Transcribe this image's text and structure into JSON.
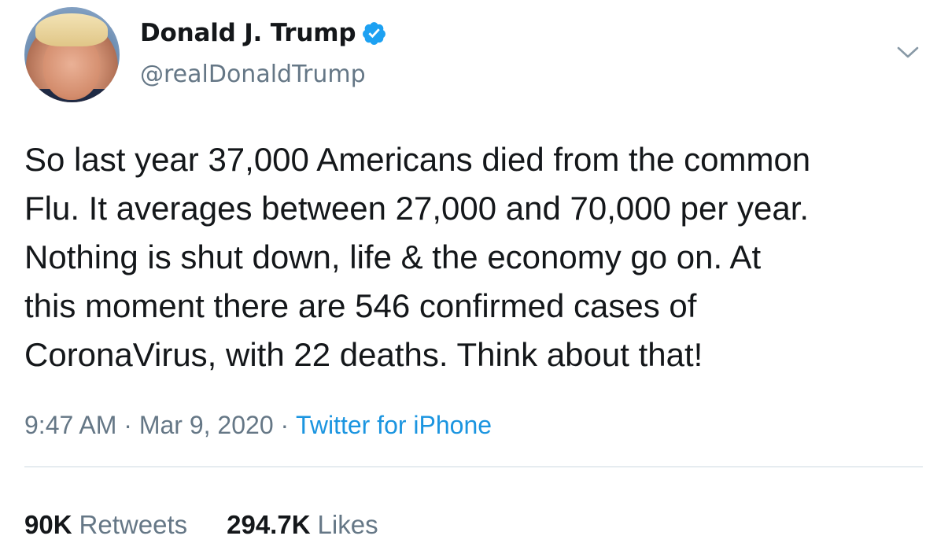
{
  "author": {
    "display_name": "Donald J. Trump",
    "handle": "@realDonaldTrump",
    "verified_icon": "verified-badge-icon",
    "avatar": "profile-avatar"
  },
  "tweet": {
    "text": "So last year 37,000 Americans died from the common\nFlu. It averages between 27,000 and 70,000 per year.\nNothing is shut down, life & the economy go on. At\nthis moment there are 546 confirmed cases of\nCoronaVirus, with 22 deaths. Think about that!"
  },
  "meta": {
    "time": "9:47 AM",
    "separator": "·",
    "date": "Mar 9, 2020",
    "source": "Twitter for iPhone"
  },
  "stats": {
    "retweets_count": "90K",
    "retweets_label": "Retweets",
    "likes_count": "294.7K",
    "likes_label": "Likes"
  },
  "colors": {
    "text": "#14171a",
    "secondary": "#657786",
    "link": "#1b95e0",
    "verified": "#1da1f2",
    "divider": "#e6ecf0"
  }
}
